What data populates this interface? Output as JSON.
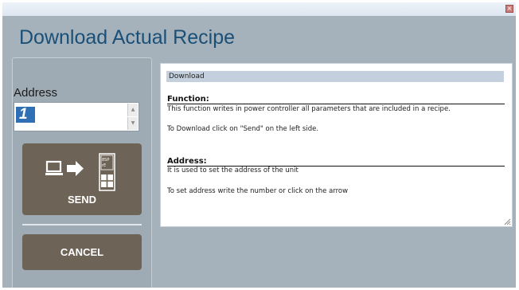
{
  "window": {
    "title": "Download Actual Recipe",
    "close_glyph": "×"
  },
  "address": {
    "label": "Address",
    "value": "1",
    "spin_up": "▲",
    "spin_down": "▼"
  },
  "buttons": {
    "send_label": "SEND",
    "cancel_label": "CANCEL"
  },
  "help": {
    "header": "Download",
    "sections": [
      {
        "heading": "Function:",
        "lines": [
          "This function writes in power controller all parameters that are included in a recipe.",
          "To Download click on \"Send\" on the left side."
        ]
      },
      {
        "heading": "Address:",
        "lines": [
          "It is used to set the address of the unit",
          "To set address write the number or click on the arrow"
        ]
      }
    ]
  },
  "icons": {
    "send": "laptop-to-controller-icon",
    "close": "close-icon",
    "resize": "resize-grip-icon"
  },
  "colors": {
    "title": "#1a5078",
    "background": "#a6b2bb",
    "button": "#6e6357",
    "help_header": "#c4d0dd",
    "input_highlight": "#2f6fb3",
    "close_button": "#c97d7b"
  }
}
